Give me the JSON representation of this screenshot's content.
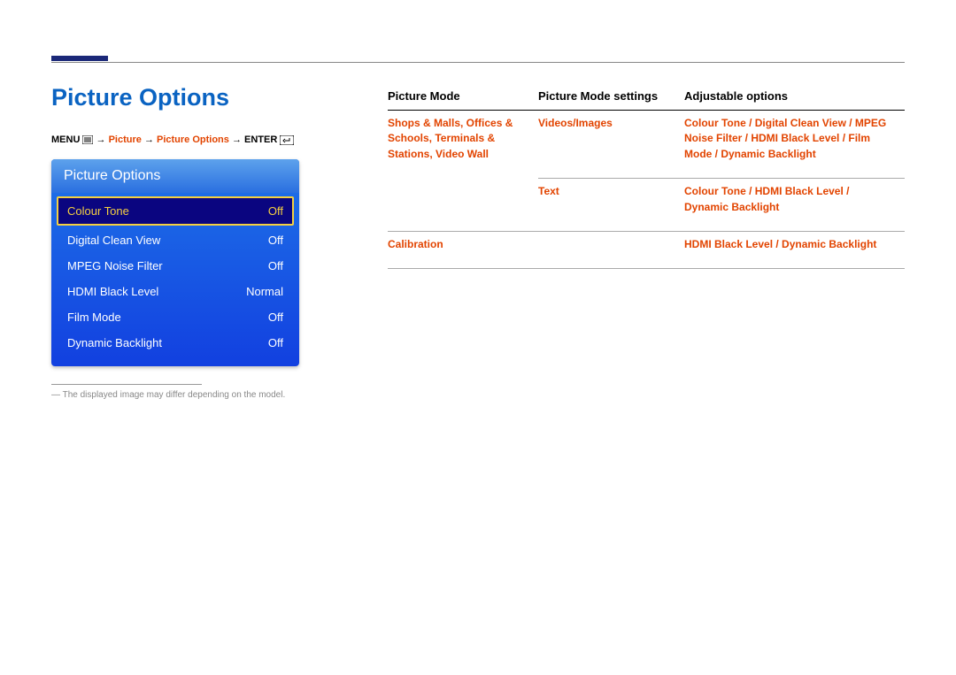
{
  "page": {
    "title": "Picture Options",
    "footnote": "― The displayed image may differ depending on the model."
  },
  "breadcrumb": {
    "menu_label": "MENU",
    "arrow": "→",
    "p1": "Picture",
    "p2": "Picture Options",
    "enter_label": "ENTER"
  },
  "osd": {
    "header": "Picture Options",
    "rows": [
      {
        "label": "Colour Tone",
        "value": "Off",
        "selected": true
      },
      {
        "label": "Digital Clean View",
        "value": "Off",
        "selected": false
      },
      {
        "label": "MPEG Noise Filter",
        "value": "Off",
        "selected": false
      },
      {
        "label": "HDMI Black Level",
        "value": "Normal",
        "selected": false
      },
      {
        "label": "Film Mode",
        "value": "Off",
        "selected": false
      },
      {
        "label": "Dynamic Backlight",
        "value": "Off",
        "selected": false
      }
    ]
  },
  "table": {
    "headers": {
      "mode": "Picture Mode",
      "settings": "Picture Mode settings",
      "adjustable": "Adjustable options"
    },
    "rows": [
      {
        "mode": "Shops & Malls, Offices & Schools, Terminals & Stations, Video Wall",
        "settings": "Videos/Images",
        "adjustable": "Colour Tone / Digital Clean View / MPEG Noise Filter / HDMI Black Level / Film Mode / Dynamic Backlight"
      },
      {
        "mode": "",
        "settings": "Text",
        "adjustable": "Colour Tone / HDMI Black Level / Dynamic Backlight"
      },
      {
        "mode": "Calibration",
        "settings": "",
        "adjustable": "HDMI Black Level / Dynamic Backlight"
      }
    ]
  }
}
